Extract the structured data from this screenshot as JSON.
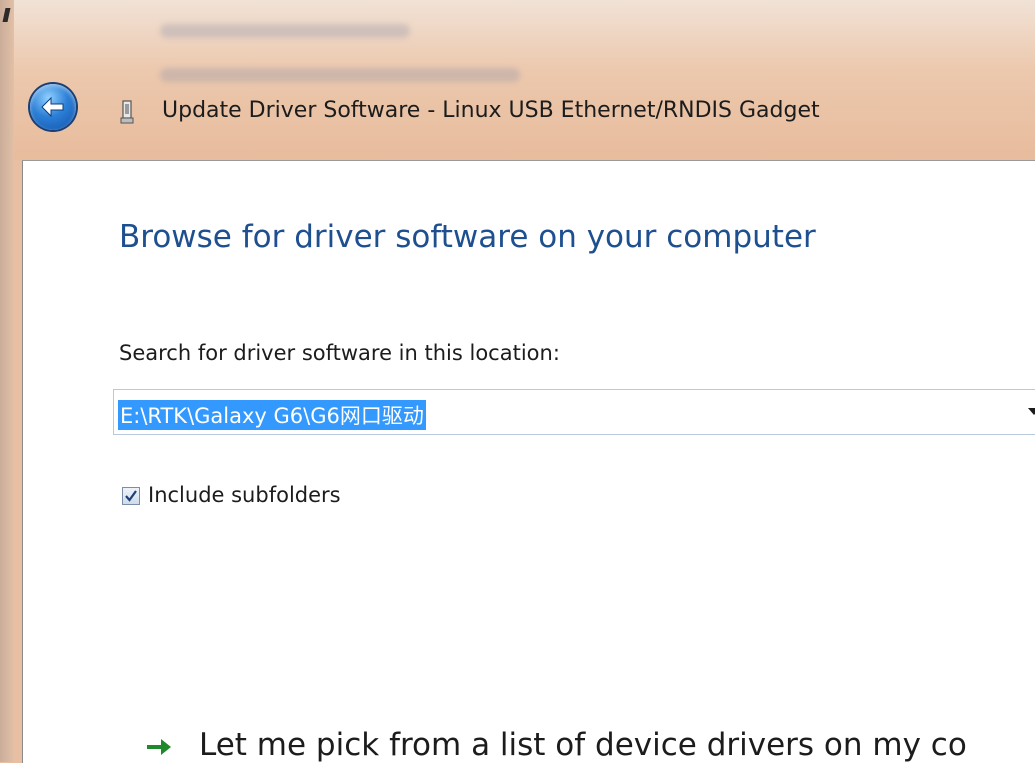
{
  "titlebar": {
    "title": "Update Driver Software - Linux USB Ethernet/RNDIS Gadget"
  },
  "dialog": {
    "heading": "Browse for driver software on your computer",
    "search_label": "Search for driver software in this location:",
    "location_value": "E:\\RTK\\Galaxy G6\\G6网口驱动",
    "include_subfolders_label": "Include subfolders",
    "include_subfolders_checked": true,
    "pick_link_text": "Let me pick from a list of device drivers on my co"
  },
  "colors": {
    "heading": "#1e4f8f",
    "selection": "#3399ff",
    "link_arrow": "#1f8a2b"
  },
  "icons": {
    "back": "back-arrow-icon",
    "device": "usb-device-icon",
    "dropdown": "chevron-down-icon",
    "checkmark": "checkmark-icon",
    "link_arrow": "green-arrow-icon"
  }
}
